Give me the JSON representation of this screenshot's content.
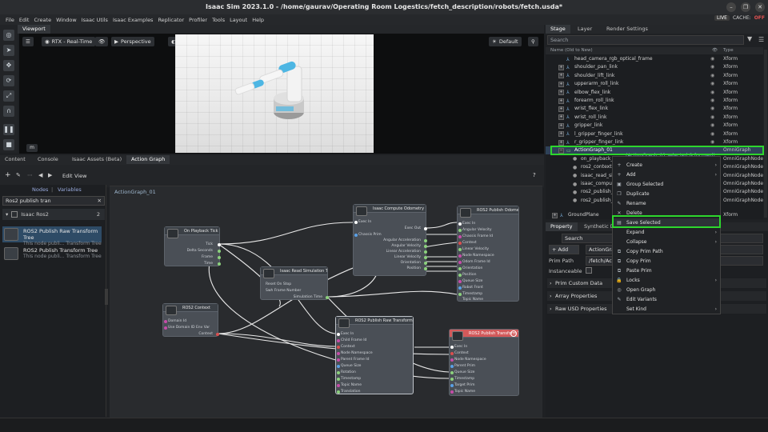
{
  "window": {
    "title": "Isaac Sim 2023.1.0 - /home/gaurav/Operating Room Logestics/fetch_description/robots/fetch.usda*",
    "live": "LIVE",
    "cache_label": "CACHE:",
    "cache_state": "OFF"
  },
  "menu": [
    "File",
    "Edit",
    "Create",
    "Window",
    "Isaac Utils",
    "Isaac Examples",
    "Replicator",
    "Profiler",
    "Tools",
    "Layout",
    "Help"
  ],
  "viewport": {
    "tab": "Viewport",
    "render_mode": "RTX - Real-Time",
    "camera": "Perspective",
    "lighting": "Default",
    "m_button": "m"
  },
  "bottom_tabs": [
    "Content",
    "Console",
    "Isaac Assets (Beta)",
    "Action Graph"
  ],
  "graph_toolbar": {
    "edit": "Edit",
    "view": "View",
    "help": "?"
  },
  "node_library": {
    "tab_nodes": "Nodes",
    "tab_variables": "Variables",
    "search_value": "Ros2 publish tran",
    "category": "Isaac Ros2",
    "category_count": "2",
    "items": [
      {
        "title": "ROS2 Publish Raw Transform Tree",
        "desc": "This node publi... Transform Tree"
      },
      {
        "title": "ROS2 Publish Transform Tree",
        "desc": "This node publi... Transform Tree"
      }
    ]
  },
  "graph": {
    "label": "ActionGraph_01",
    "nodes": {
      "playback": {
        "title": "On Playback Tick",
        "ports": [
          "Tick",
          "Delta Seconds",
          "Frame",
          "Time"
        ]
      },
      "context": {
        "title": "ROS2 Context",
        "ports": [
          "Domain Id",
          "Use Domain ID Env Var",
          "Context"
        ]
      },
      "simtime": {
        "title": "Isaac Read Simulation Time",
        "ports": [
          "Reset On Stop",
          "Swh Frame Number",
          "Simulation Time"
        ]
      },
      "odom_comp": {
        "title": "Isaac Compute Odometry Node",
        "ports": [
          "Exec In",
          "Chassis Prim",
          "Exec Out",
          "Angular Acceleration",
          "Angular Velocity",
          "Linear Acceleration",
          "Linear Velocity",
          "Orientation",
          "Position"
        ]
      },
      "pub_odom": {
        "title": "ROS2 Publish Odometry",
        "ports": [
          "Exec In",
          "Angular Velocity",
          "Chassis Frame Id",
          "Context",
          "Linear Velocity",
          "Node Namespace",
          "Odom Frame Id",
          "Orientation",
          "Position",
          "Queue Size",
          "Robot Front",
          "Timestamp",
          "Topic Name"
        ]
      },
      "raw_tf": {
        "title": "ROS2 Publish Raw Transform Tree",
        "ports": [
          "Exec In",
          "Child Frame Id",
          "Context",
          "Node Namespace",
          "Parent Frame Id",
          "Queue Size",
          "Rotation",
          "Timestamp",
          "Topic Name",
          "Translation"
        ]
      },
      "pub_tf": {
        "title": "ROS2 Publish Transform Tree",
        "ports": [
          "Exec In",
          "Context",
          "Node Namespace",
          "Parent Prim",
          "Queue Size",
          "Timestamp",
          "Target Prim",
          "Topic Name"
        ]
      }
    }
  },
  "stage": {
    "tabs": [
      "Stage",
      "Layer",
      "Render Settings"
    ],
    "search_placeholder": "Search",
    "col_name": "Name (Old to New)",
    "col_type": "Type",
    "rows": [
      {
        "name": "head_camera_rgb_optical_frame",
        "type": "Xform",
        "expand": false
      },
      {
        "name": "shoulder_pan_link",
        "type": "Xform",
        "expand": true
      },
      {
        "name": "shoulder_lift_link",
        "type": "Xform",
        "expand": true
      },
      {
        "name": "upperarm_roll_link",
        "type": "Xform",
        "expand": true
      },
      {
        "name": "elbow_flex_link",
        "type": "Xform",
        "expand": true
      },
      {
        "name": "forearm_roll_link",
        "type": "Xform",
        "expand": true
      },
      {
        "name": "wrist_flex_link",
        "type": "Xform",
        "expand": true
      },
      {
        "name": "wrist_roll_link",
        "type": "Xform",
        "expand": true
      },
      {
        "name": "gripper_link",
        "type": "Xform",
        "expand": true
      },
      {
        "name": "l_gripper_finger_link",
        "type": "Xform",
        "expand": true
      },
      {
        "name": "r_gripper_finger_link",
        "type": "Xform",
        "expand": true
      },
      {
        "name": "ActionGraph_01",
        "type": "OmniGraph",
        "expand": true
      },
      {
        "name": "on_playback_tick",
        "type": "OmniGraphNode",
        "expand": false
      },
      {
        "name": "ros2_context",
        "type": "OmniGraphNode",
        "expand": false
      },
      {
        "name": "isaac_read_simulation_time",
        "type": "OmniGraphNode",
        "expand": false
      },
      {
        "name": "isaac_compute_odometry",
        "type": "OmniGraphNode",
        "expand": false
      },
      {
        "name": "ros2_publish_odometry",
        "type": "OmniGraphNode",
        "expand": false
      },
      {
        "name": "ros2_publish_raw_transform_tree",
        "type": "OmniGraphNode",
        "expand": false
      },
      {
        "name": "GroundPlane",
        "type": "Xform",
        "expand": true
      }
    ],
    "selection_note": "(ActionGraph_01 selected & focused)"
  },
  "context_menu": [
    {
      "label": "Create",
      "icon": "+",
      "sub": true
    },
    {
      "label": "Add",
      "icon": "+",
      "sub": true
    },
    {
      "label": "Group Selected",
      "icon": "▣",
      "sub": false
    },
    {
      "label": "Duplicate",
      "icon": "❐",
      "sub": false
    },
    {
      "label": "Rename",
      "icon": "✎",
      "sub": false
    },
    {
      "label": "Delete",
      "icon": "✕",
      "sub": false
    },
    {
      "label": "Save Selected",
      "icon": "▤",
      "sub": false
    },
    {
      "label": "Expand",
      "icon": "",
      "sub": true
    },
    {
      "label": "Collapse",
      "icon": "",
      "sub": true
    },
    {
      "label": "Copy Prim Path",
      "icon": "⧉",
      "sub": false
    },
    {
      "label": "Copy Prim",
      "icon": "⧉",
      "sub": false
    },
    {
      "label": "Paste Prim",
      "icon": "⧉",
      "sub": false
    },
    {
      "label": "Locks",
      "icon": "🔒",
      "sub": true
    },
    {
      "label": "Open Graph",
      "icon": "◎",
      "sub": false
    },
    {
      "label": "Edit Variants",
      "icon": "✎",
      "sub": false
    },
    {
      "label": "Set Kind",
      "icon": "",
      "sub": true
    }
  ],
  "property": {
    "tabs": [
      "Property",
      "Synthetic Data"
    ],
    "search_placeholder": "Search",
    "add_label": "Add",
    "name_value": "ActionGraph_01",
    "prim_path_label": "Prim Path",
    "prim_path_value": "/fetch/ActionGraph_01",
    "instanceable_label": "Instanceable",
    "sections": [
      "Prim Custom Data",
      "Array Properties",
      "Raw USD Properties"
    ]
  }
}
